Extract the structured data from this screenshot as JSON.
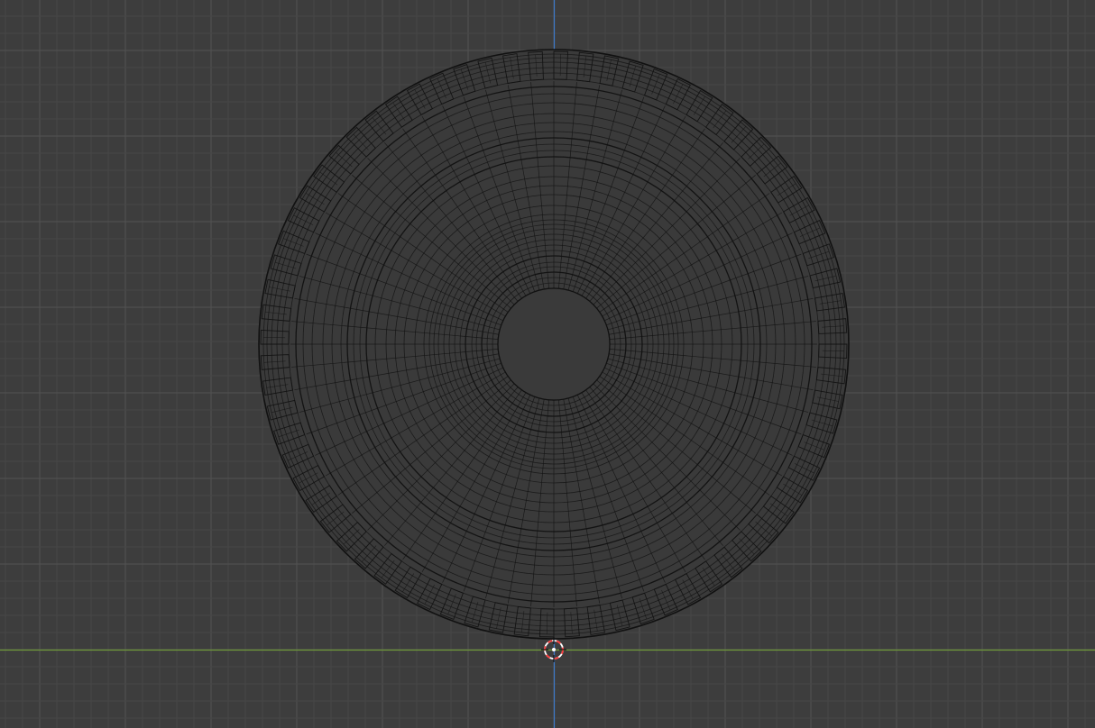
{
  "viewport": {
    "mode": "wireframe",
    "view": "front-orthographic",
    "background_color": "#3d3d3d",
    "grid_minor_color": "#474747",
    "grid_major_color": "#525252",
    "x_axis_color": "#6f9a3a",
    "z_axis_color": "#3d79c9",
    "wire_color": "#111111",
    "mesh_fill_color": "#3a3a3a",
    "cursor_colors": [
      "#ff3b3b",
      "#ffffff"
    ]
  },
  "object": {
    "type": "tire",
    "spokes": 72,
    "tread_blocks": 72
  },
  "cursor": {
    "icon": "3d-cursor-icon"
  }
}
